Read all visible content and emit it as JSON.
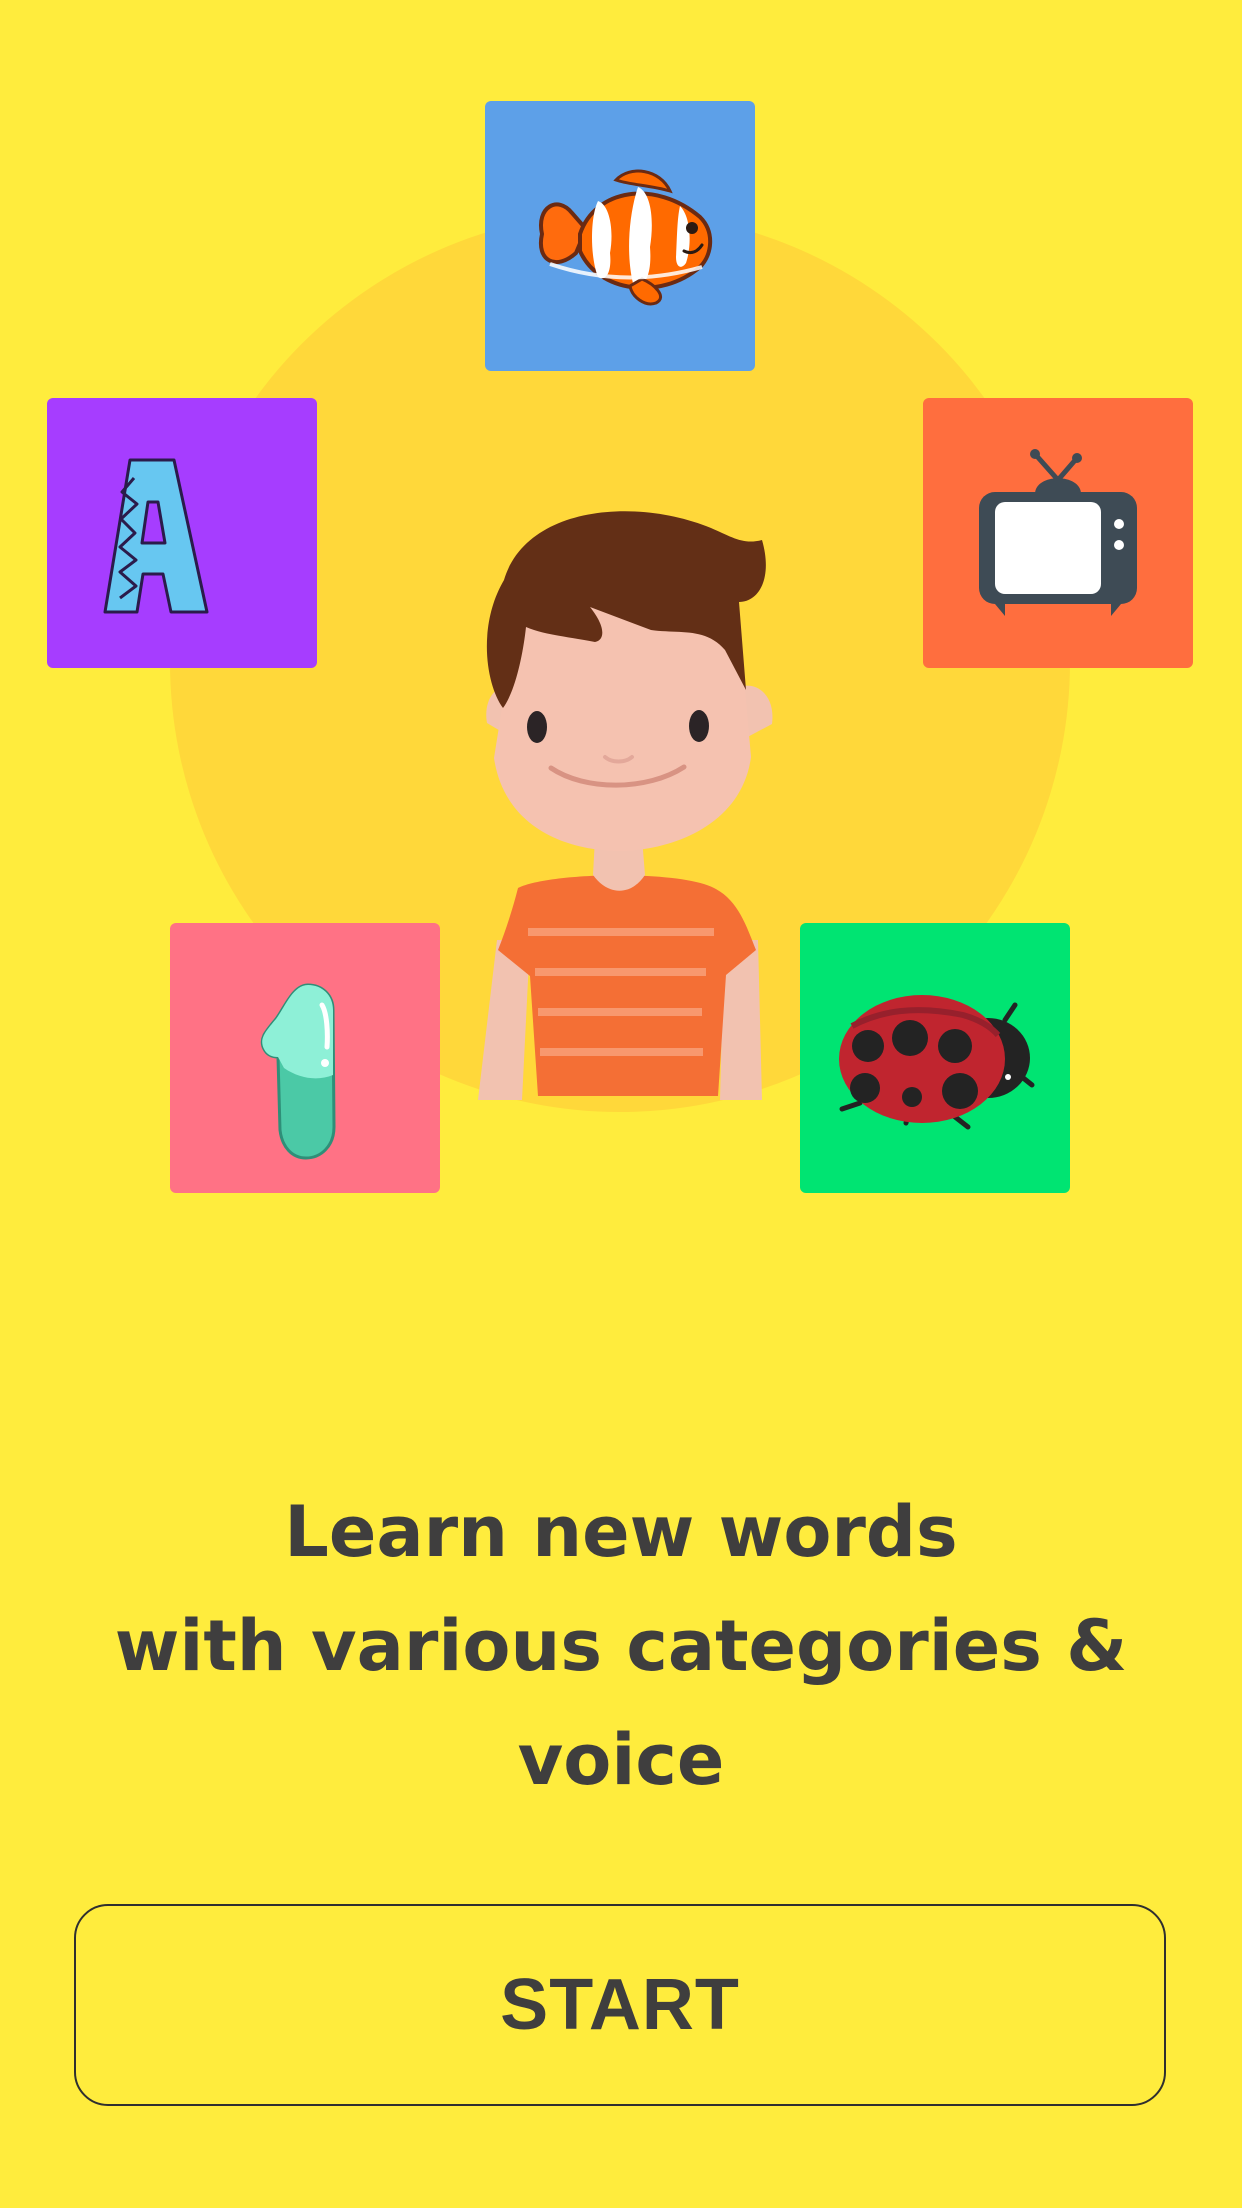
{
  "app": {
    "tiles": [
      {
        "id": "fish",
        "icon": "clownfish-icon",
        "color": "#5da0e8"
      },
      {
        "id": "letter",
        "icon": "letter-a-icon",
        "color": "#a63dff"
      },
      {
        "id": "tv",
        "icon": "television-icon",
        "color": "#ff6e3e"
      },
      {
        "id": "number",
        "icon": "number-one-icon",
        "color": "#ff7285"
      },
      {
        "id": "ladybug",
        "icon": "ladybug-icon",
        "color": "#00e472"
      }
    ],
    "headline": {
      "line1": "Learn new words",
      "line2": "with various categories & voice"
    },
    "start_button": {
      "label": "START"
    },
    "colors": {
      "background": "#ffec3d",
      "glow": "#ffd83a",
      "text": "#3f3e3e"
    }
  }
}
